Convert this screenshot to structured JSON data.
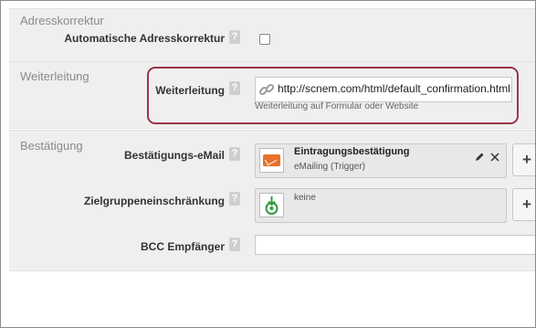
{
  "adresskorrektur": {
    "title": "Adresskorrektur",
    "auto_label": "Automatische Adresskorrektur",
    "help": "?"
  },
  "weiterleitung": {
    "title": "Weiterleitung",
    "field_label": "Weiterleitung",
    "help": "?",
    "url_value": "http://scnem.com/html/default_confirmation.html",
    "hint": "Weiterleitung auf Formular oder Website",
    "highlight_color": "#9a3546"
  },
  "bestaetigung": {
    "title": "Bestätigung",
    "email_label": "Bestätigungs-eMail",
    "email_card_title": "Eintragungsbestätigung",
    "email_card_subtitle": "eMailing (Trigger)",
    "target_label": "Zielgruppeneinschränkung",
    "target_value": "keine",
    "bcc_label": "BCC Empfänger",
    "help": "?",
    "add_symbol": "+",
    "edit_icon": "pencil-icon",
    "remove_icon": "close-icon"
  }
}
